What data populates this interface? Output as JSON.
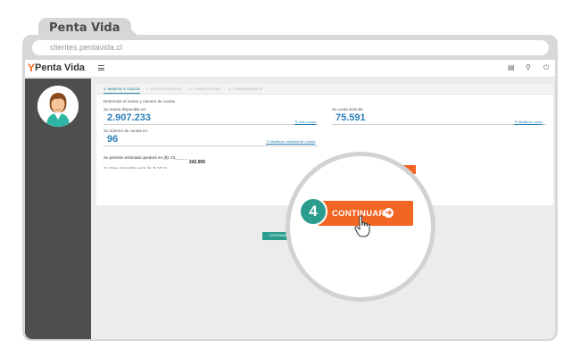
{
  "browser": {
    "tab_title": "Penta Vida",
    "url": "clientes.pentavida.cl"
  },
  "app": {
    "logo_mark": "Y",
    "logo_text": "Penta Vida"
  },
  "steps": [
    {
      "label": "1. MONTO Y CUOTA"
    },
    {
      "label": "2. ANTECEDENTES"
    },
    {
      "label": "3. CONDICIONES"
    },
    {
      "label": "4. COMPROBANTE"
    }
  ],
  "form": {
    "intro": "Determine el monto y número de cuotas",
    "amount_label": "Su monto disponible es:",
    "amount_value": "2.907.233",
    "amount_link": "Otro monto",
    "fee_label": "Su cuota será de:",
    "fee_value": "75.591",
    "fee_link": "Modificar cuota",
    "installments_label": "Su número de cuotas es:",
    "installments_value": "96",
    "installments_link": "Modificar cantidad de cuotas",
    "pension_text": "Su pensión estimada quedará en ($): 23_ _ _ _",
    "pension_value": "242.905",
    "cut_text": "Su base imponible será de: $ 242.9",
    "view_offer_button": "VER OFERTA INICIAL",
    "calculate_button": "CALCULAR",
    "continue_small_button": "CONTINUAR SIMULACIÓN"
  },
  "callout": {
    "step_number": "4",
    "continue_label": "CONTINUAR"
  },
  "colors": {
    "accent_orange": "#f26522",
    "teal": "#2a9d8f",
    "value_blue": "#2a7fb8",
    "sidebar": "#4d4f4d"
  }
}
